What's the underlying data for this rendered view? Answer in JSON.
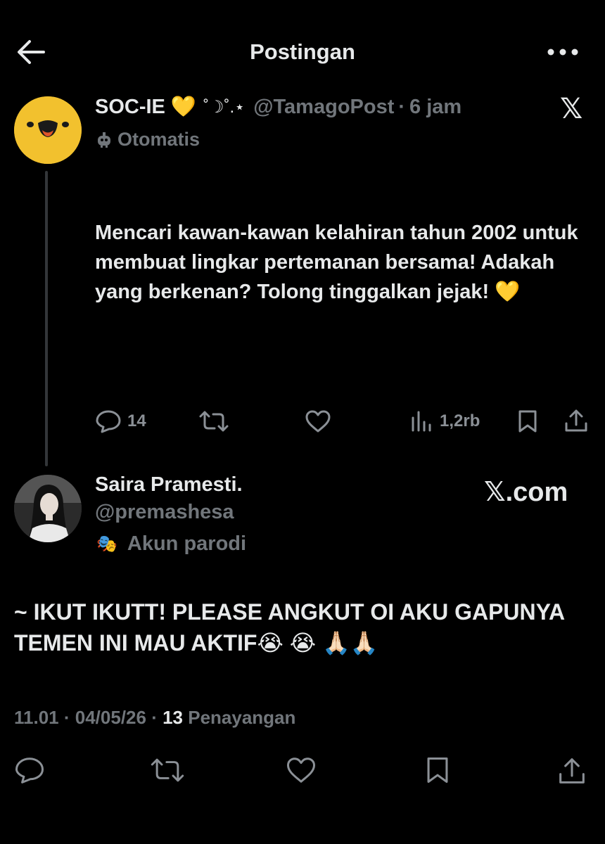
{
  "header": {
    "title": "Postingan"
  },
  "post": {
    "display_name": "SOC-IE",
    "name_emoji": "💛",
    "name_decoration": "˚☽˚.⋆",
    "handle": "@TamagoPost",
    "separator": "·",
    "time": "6 jam",
    "automated_label": "Otomatis",
    "x_logo": "𝕏",
    "text": "Mencari kawan-kawan kelahiran tahun 2002 untuk membuat lingkar pertemanan bersama! Adakah yang berkenan?  Tolong tinggalkan jejak! 💛",
    "stats": {
      "replies": "14",
      "views": "1,2rb"
    }
  },
  "reply": {
    "display_name": "Saira Pramesti.",
    "handle": "@premashesa",
    "parody_emoji": "🎭",
    "parody_label": "Akun parodi",
    "source_label": "𝕏.com",
    "text": "~ IKUT IKUTT! PLEASE ANGKUT OI AKU GAPUNYA TEMEN INI MAU AKTIF😭 😭 🙏🏻🙏🏻",
    "meta": {
      "time": "11.01",
      "sep1": " · ",
      "date": "04/05/26",
      "sep2": " · ",
      "views_count": "13",
      "views_label": "Penayangan"
    }
  },
  "colors": {
    "background": "#000000",
    "text": "#e7e9ea",
    "muted": "#71767b",
    "avatar_yellow": "#f2c12e",
    "thread_line": "#333639"
  },
  "icons": [
    "back-arrow-icon",
    "more-icon",
    "robot-icon",
    "reply-icon",
    "retweet-icon",
    "like-icon",
    "views-icon",
    "bookmark-icon",
    "share-icon",
    "parody-mask-icon"
  ]
}
